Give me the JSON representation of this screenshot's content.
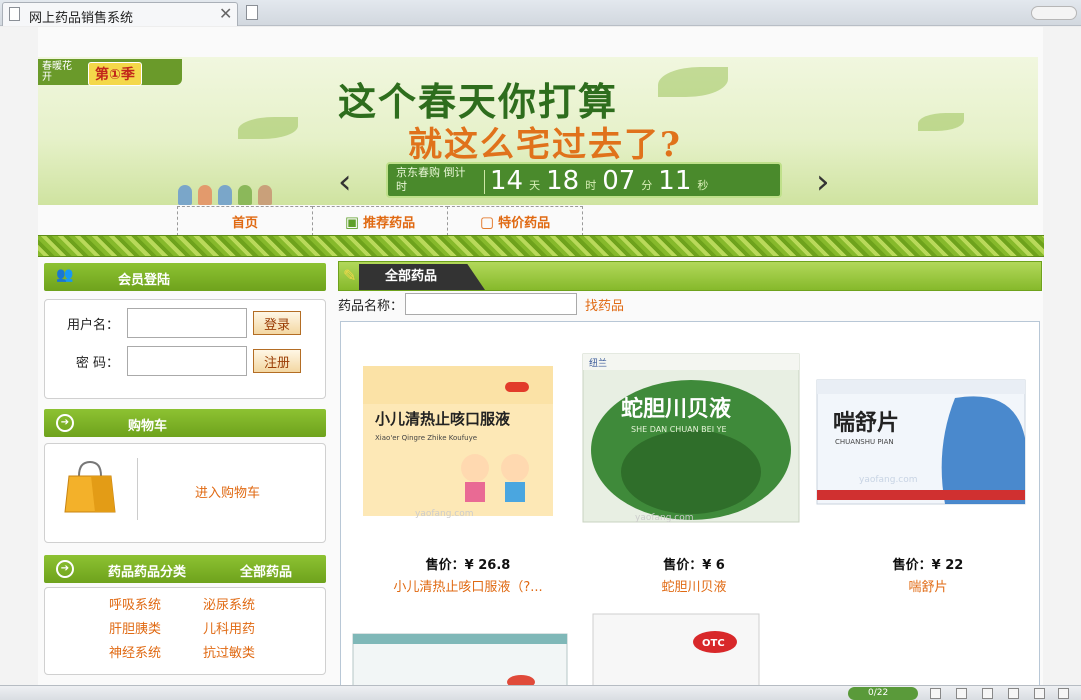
{
  "browser": {
    "tab_title": "网上药品销售系统",
    "close_glyph": "✕",
    "status_text": "0/22"
  },
  "banner": {
    "badge_left": "春暖花开",
    "badge_right": "第①季",
    "headline": "这个春天你打算",
    "subline": "就这么宅过去了?",
    "countdown_label": "京东春购 倒计时",
    "countdown": {
      "days": "14",
      "days_unit": "天",
      "hours": "18",
      "hours_unit": "时",
      "minutes": "07",
      "minutes_unit": "分",
      "seconds": "11",
      "seconds_unit": "秒"
    },
    "prev_glyph": "‹",
    "next_glyph": "›"
  },
  "nav": {
    "home": "首页",
    "recommended": "推荐药品",
    "special": "特价药品"
  },
  "login": {
    "title": "会员登陆",
    "username_label": "用户名：",
    "password_label": "密  码：",
    "login_button": "登录",
    "register_button": "注册"
  },
  "cart": {
    "title": "购物车",
    "enter_link": "进入购物车"
  },
  "categories": {
    "title": "药品药品分类",
    "all_link": "全部药品",
    "items": [
      "呼吸系统",
      "泌尿系统",
      "肝胆胰类",
      "儿科用药",
      "神经系统",
      "抗过敏类"
    ]
  },
  "main": {
    "title": "全部药品",
    "search_label": "药品名称：",
    "search_button": "找药品",
    "products": [
      {
        "price": "售价：¥  26.8",
        "name": "小儿清热止咳口服液（?...",
        "box_text": "小儿清热止咳口服液",
        "box_pinyin": "Xiao'er Qingre Zhike Koufuye",
        "box_color": "#f6b53a"
      },
      {
        "price": "售价：¥  6",
        "name": "蛇胆川贝液",
        "box_text": "蛇胆川贝液",
        "box_pinyin": "SHE DAN CHUAN BEI YE",
        "box_color": "#3f8a3a"
      },
      {
        "price": "售价：¥  22",
        "name": "喘舒片",
        "box_text": "喘舒片",
        "box_pinyin": "CHUANSHU PIAN",
        "box_color": "#2d76c4"
      }
    ],
    "watermark": "yaofang.com",
    "brand_tag": "纽兰",
    "otc": "OTC"
  }
}
